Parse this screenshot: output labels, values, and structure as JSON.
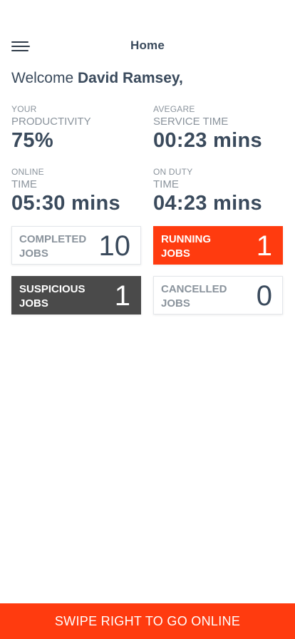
{
  "header": {
    "title": "Home"
  },
  "welcome": {
    "greeting": "Welcome",
    "name": "David Ramsey,"
  },
  "stats": [
    {
      "label_top": "YOUR",
      "label_bottom": "PRODUCTIVITY",
      "value": "75%"
    },
    {
      "label_top": "AVEGARE",
      "label_bottom": "SERVICE TIME",
      "value": "00:23 mins"
    },
    {
      "label_top": "ONLINE",
      "label_bottom": "TIME",
      "value": "05:30 mins"
    },
    {
      "label_top": "ON DUTY",
      "label_bottom": "TIME",
      "value": "04:23 mins"
    }
  ],
  "job_cards": [
    {
      "line1": "COMPLETED",
      "line2": "JOBS",
      "count": "10"
    },
    {
      "line1": "RUNNING",
      "line2": "JOBS",
      "count": "1"
    },
    {
      "line1": "SUSPICIOUS",
      "line2": "JOBS",
      "count": "1"
    },
    {
      "line1": "CANCELLED",
      "line2": "JOBS",
      "count": "0"
    }
  ],
  "colors": {
    "accent": "#ff3b0f",
    "dark_card": "#4a4a4a",
    "text": "#3a4a5c",
    "muted": "#8a939c"
  },
  "cta": {
    "label": "SWIPE RIGHT TO GO ONLINE"
  }
}
